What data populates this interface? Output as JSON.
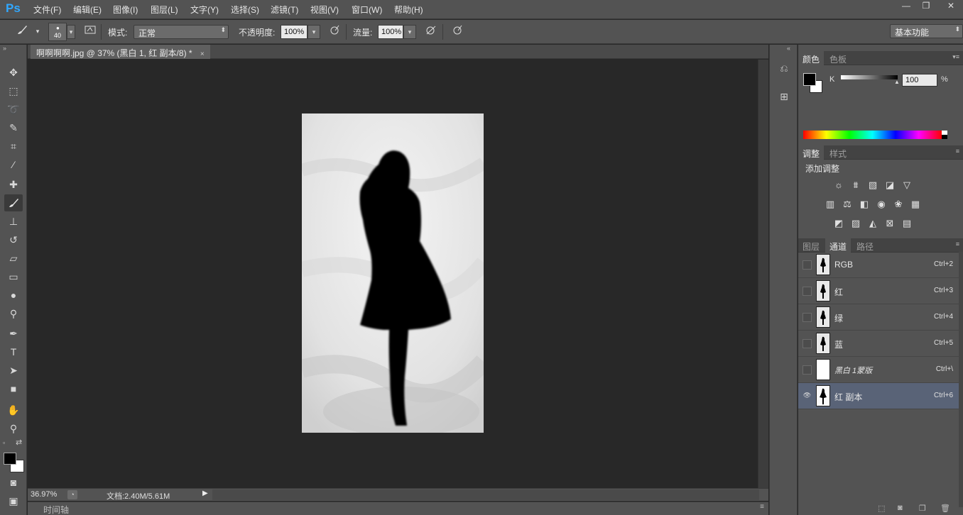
{
  "app": {
    "logo": "Ps"
  },
  "menu": [
    "文件(F)",
    "编辑(E)",
    "图像(I)",
    "图层(L)",
    "文字(Y)",
    "选择(S)",
    "滤镜(T)",
    "视图(V)",
    "窗口(W)",
    "帮助(H)"
  ],
  "window_controls": {
    "minimize": "—",
    "restore": "❐",
    "close": "✕"
  },
  "options": {
    "brush_size": "40",
    "mode_label": "模式:",
    "mode_value": "正常",
    "opacity_label": "不透明度:",
    "opacity_value": "100%",
    "flow_label": "流量:",
    "flow_value": "100%",
    "workspace": "基本功能"
  },
  "document": {
    "tab_title": "啊啊啊啊.jpg @ 37% (黑白 1, 红 副本/8) *",
    "close": "×"
  },
  "status": {
    "zoom": "36.97%",
    "doc_info": "文档:2.40M/5.61M"
  },
  "timeline": {
    "label": "时间轴"
  },
  "color_panel": {
    "tabs": [
      "颜色",
      "色板"
    ],
    "channel_label": "K",
    "value": "100",
    "unit": "%"
  },
  "adjust_panel": {
    "tabs": [
      "调整",
      "样式"
    ],
    "title": "添加调整"
  },
  "channels_panel": {
    "tabs": [
      "图层",
      "通道",
      "路径"
    ],
    "active_tab": 1,
    "rows": [
      {
        "name": "RGB",
        "shortcut": "Ctrl+2",
        "visible": false,
        "selected": false,
        "thumb": "gray"
      },
      {
        "name": "红",
        "shortcut": "Ctrl+3",
        "visible": false,
        "selected": false,
        "thumb": "gray"
      },
      {
        "name": "绿",
        "shortcut": "Ctrl+4",
        "visible": false,
        "selected": false,
        "thumb": "gray"
      },
      {
        "name": "蓝",
        "shortcut": "Ctrl+5",
        "visible": false,
        "selected": false,
        "thumb": "gray"
      },
      {
        "name": "黑白 1蒙版",
        "shortcut": "Ctrl+\\",
        "visible": false,
        "selected": false,
        "thumb": "white"
      },
      {
        "name": "红 副本",
        "shortcut": "Ctrl+6",
        "visible": true,
        "selected": true,
        "thumb": "silhouette"
      }
    ]
  },
  "colors": {
    "selected_row": "#596377",
    "accent": "#31a8ff"
  }
}
